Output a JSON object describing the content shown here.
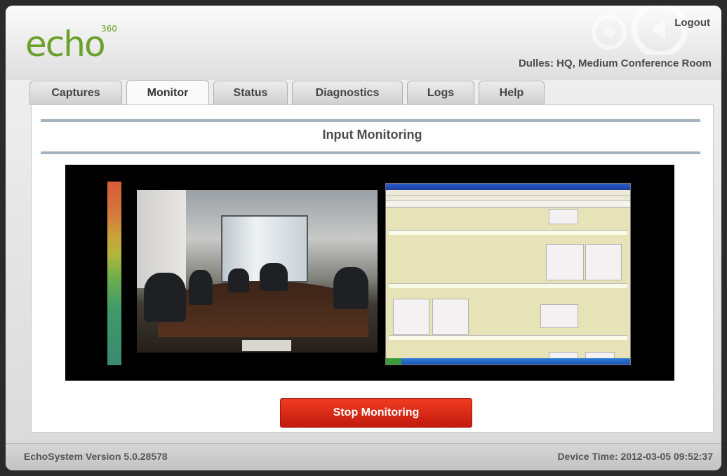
{
  "app": {
    "logo_text": "echo",
    "logo_superscript": "360",
    "logout_label": "Logout",
    "location": "Dulles: HQ, Medium Conference Room"
  },
  "tabs": [
    {
      "label": "Captures",
      "active": false
    },
    {
      "label": "Monitor",
      "active": true
    },
    {
      "label": "Status",
      "active": false
    },
    {
      "label": "Diagnostics",
      "active": false
    },
    {
      "label": "Logs",
      "active": false
    },
    {
      "label": "Help",
      "active": false
    }
  ],
  "main": {
    "section_title": "Input Monitoring",
    "stop_button_label": "Stop Monitoring"
  },
  "footer": {
    "version_text": "EchoSystem Version 5.0.28578",
    "device_time_text": "Device Time: 2012-03-05 09:52:37"
  },
  "colors": {
    "brand_green": "#6aa12a",
    "stop_red": "#d9250f",
    "rule_blue": "#a6b4c2"
  }
}
